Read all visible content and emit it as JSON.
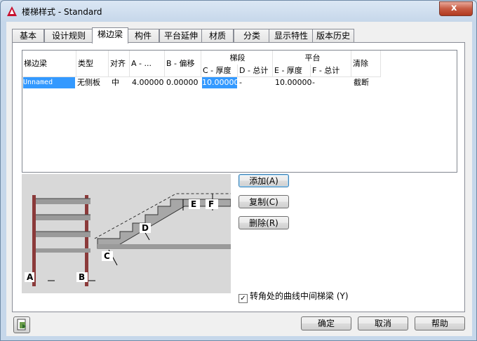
{
  "window": {
    "title": "楼梯样式 - Standard",
    "close_label": "x"
  },
  "tabs": [
    "基本",
    "设计规则",
    "梯边梁",
    "构件",
    "平台延伸",
    "材质",
    "分类",
    "显示特性",
    "版本历史"
  ],
  "active_tab": "梯边梁",
  "table": {
    "headers": {
      "name": "梯边梁",
      "type": "类型",
      "align": "对齐",
      "a": "A - ...",
      "b": "B - 偏移",
      "group_flight": "梯段",
      "c": "C - 厚度",
      "d": "D - 总计",
      "group_landing": "平台",
      "e": "E - 厚度",
      "f": "F - 总计",
      "cleanup": "清除"
    },
    "rows": [
      {
        "name": "Unnamed",
        "type": "无侧板",
        "align": "中",
        "a": "4.00000",
        "b": "0.00000",
        "c": "10.00000",
        "d": "-",
        "e": "10.00000",
        "f": "-",
        "cleanup": "截断"
      }
    ]
  },
  "diagram_labels": {
    "a": "A",
    "b": "B",
    "c": "C",
    "d": "D",
    "e": "E",
    "f": "F"
  },
  "buttons": {
    "add": "添加(A)",
    "copy": "复制(C)",
    "delete": "删除(R)",
    "ok": "确定",
    "cancel": "取消",
    "help": "帮助"
  },
  "checkbox": {
    "label": "转角处的曲线中间梯梁 (Y)",
    "checked": true
  }
}
